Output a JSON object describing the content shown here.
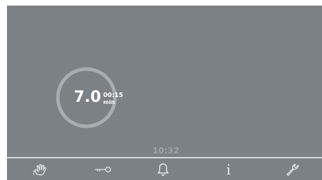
{
  "program": {
    "value": "7.0",
    "duration": "00:15",
    "duration_unit": "min",
    "progress_fraction": 1.0
  },
  "status": {
    "clock": "10:32"
  },
  "toolbar": {
    "items": [
      {
        "icon": "manual-hand-icon"
      },
      {
        "icon": "key-icon"
      },
      {
        "icon": "bell-icon"
      },
      {
        "icon": "info-icon",
        "label": "i"
      },
      {
        "icon": "wrench-icon"
      }
    ]
  },
  "colors": {
    "screen_bg": "#7b8184",
    "ring": "#a8adaf",
    "text": "#ffffff",
    "clock": "#9ea4a7",
    "icons": "#e6e8e9"
  }
}
